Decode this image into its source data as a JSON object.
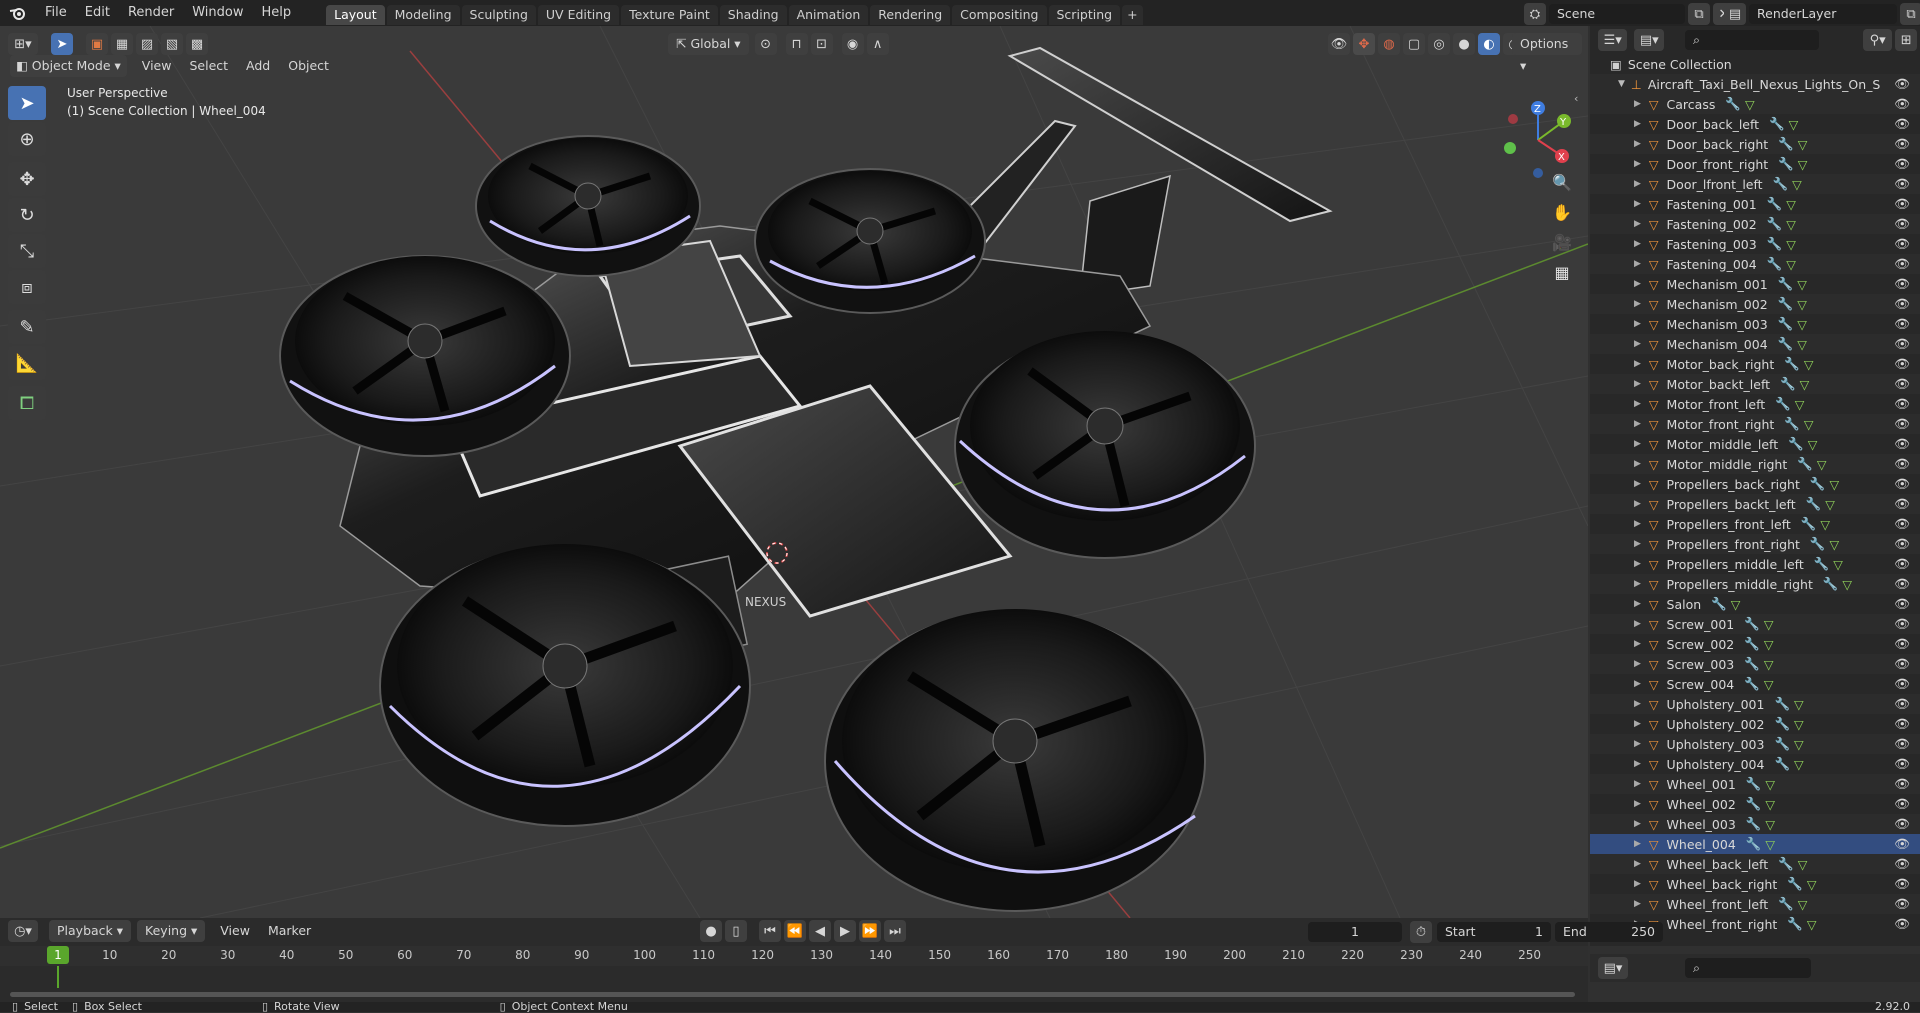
{
  "app": {
    "menus": [
      "File",
      "Edit",
      "Render",
      "Window",
      "Help"
    ],
    "workspaces": [
      "Layout",
      "Modeling",
      "Sculpting",
      "UV Editing",
      "Texture Paint",
      "Shading",
      "Animation",
      "Rendering",
      "Compositing",
      "Scripting"
    ],
    "active_workspace": "Layout",
    "scene_name": "Scene",
    "render_layer": "RenderLayer",
    "version": "2.92.0"
  },
  "viewport": {
    "mode": "Object Mode",
    "menus": [
      "View",
      "Select",
      "Add",
      "Object"
    ],
    "transform_orientation": "Global",
    "options_label": "Options",
    "overlay_line1": "User Perspective",
    "overlay_line2": "(1) Scene Collection | Wheel_004",
    "gizmo": {
      "x": "X",
      "y": "Y",
      "z": "Z"
    },
    "hub_label": "NEXUS"
  },
  "outliner": {
    "root": "Scene Collection",
    "collection": "Aircraft_Taxi_Bell_Nexus_Lights_On_Simple_",
    "selected": "Wheel_004",
    "items": [
      "Carcass",
      "Door_back_left",
      "Door_back_right",
      "Door_front_right",
      "Door_lfront_left",
      "Fastening_001",
      "Fastening_002",
      "Fastening_003",
      "Fastening_004",
      "Mechanism_001",
      "Mechanism_002",
      "Mechanism_003",
      "Mechanism_004",
      "Motor_back_right",
      "Motor_backt_left",
      "Motor_front_left",
      "Motor_front_right",
      "Motor_middle_left",
      "Motor_middle_right",
      "Propellers_back_right",
      "Propellers_backt_left",
      "Propellers_front_left",
      "Propellers_front_right",
      "Propellers_middle_left",
      "Propellers_middle_right",
      "Salon",
      "Screw_001",
      "Screw_002",
      "Screw_003",
      "Screw_004",
      "Upholstery_001",
      "Upholstery_002",
      "Upholstery_003",
      "Upholstery_004",
      "Wheel_001",
      "Wheel_002",
      "Wheel_003",
      "Wheel_004",
      "Wheel_back_left",
      "Wheel_back_right",
      "Wheel_front_left",
      "Wheel_front_right"
    ]
  },
  "timeline": {
    "menus": [
      "Playback",
      "Keying",
      "View",
      "Marker"
    ],
    "current_frame": "1",
    "start_label": "Start",
    "start_value": "1",
    "end_label": "End",
    "end_value": "250",
    "ticks": [
      "10",
      "20",
      "30",
      "40",
      "50",
      "60",
      "70",
      "80",
      "90",
      "100",
      "110",
      "120",
      "130",
      "140",
      "150",
      "160",
      "170",
      "180",
      "190",
      "200",
      "210",
      "220",
      "230",
      "240",
      "250"
    ],
    "current_tick": "1"
  },
  "status": {
    "select": "Select",
    "box_select": "Box Select",
    "rotate_view": "Rotate View",
    "context_menu": "Object Context Menu"
  },
  "colors": {
    "accent": "#4772b3",
    "object_orange": "#e8913a",
    "x_axis": "#e0404d",
    "y_axis": "#7aba2c",
    "z_axis": "#3f7de0",
    "current_frame": "#5aa62c"
  }
}
